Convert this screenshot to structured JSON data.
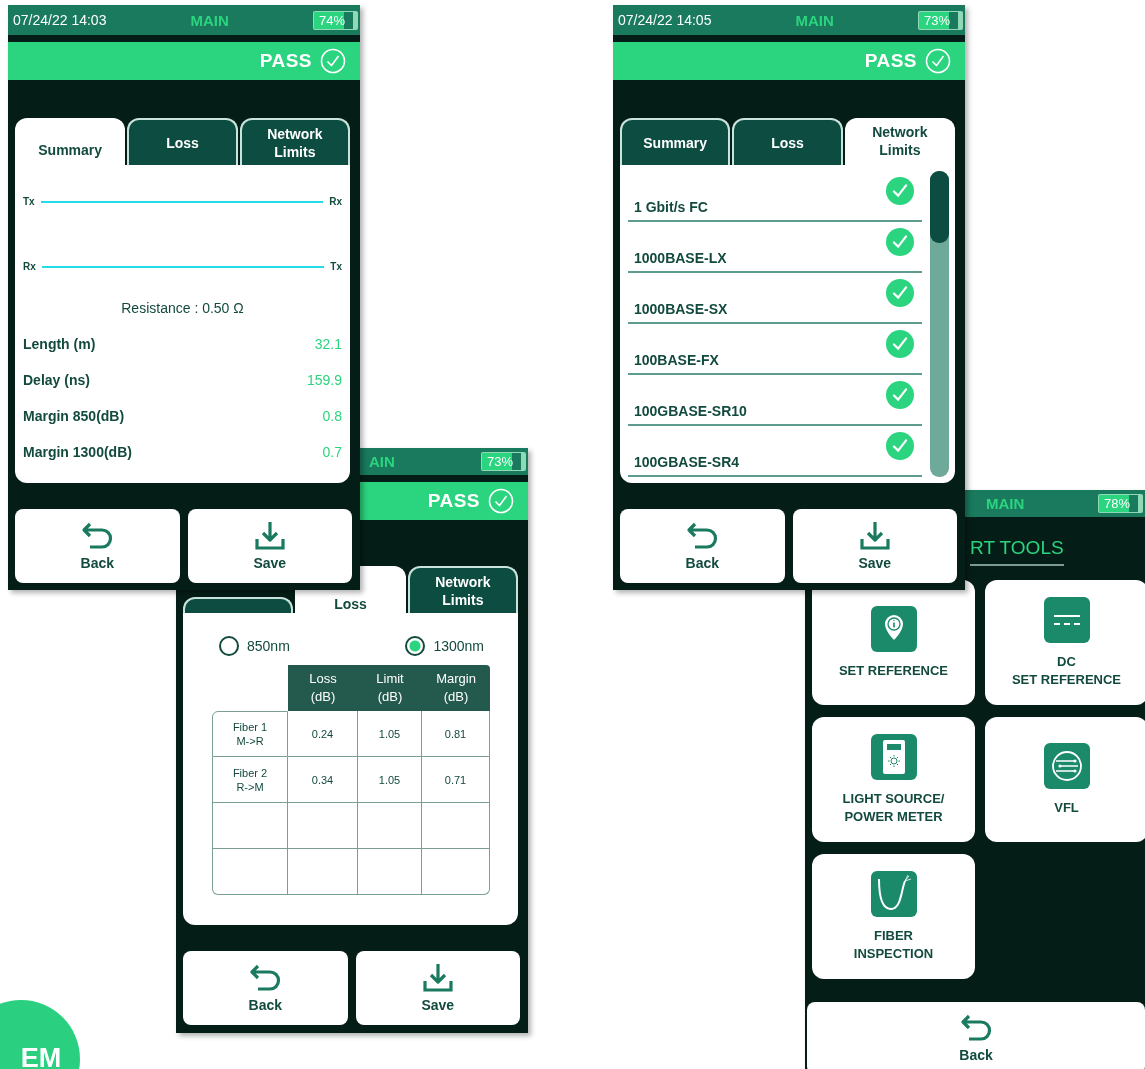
{
  "screens": [
    {
      "kind": "summary",
      "status": {
        "datetime": "07/24/22 14:03",
        "title": "MAIN",
        "battery": "74%"
      },
      "result": "PASS",
      "tabs": [
        {
          "label": "Summary",
          "selected": true
        },
        {
          "label": "Loss",
          "selected": false
        },
        {
          "label": "Network\nLimits",
          "selected": false
        }
      ],
      "links": [
        {
          "left": "Tx",
          "right": "Rx"
        },
        {
          "left": "Rx",
          "right": "Tx"
        }
      ],
      "resistance": "Resistance : 0.50 Ω",
      "measurements": [
        {
          "label": "Length (m)",
          "value": "32.1"
        },
        {
          "label": "Delay (ns)",
          "value": "159.9"
        },
        {
          "label": "Margin 850(dB)",
          "value": "0.8"
        },
        {
          "label": "Margin 1300(dB)",
          "value": "0.7"
        }
      ],
      "buttons": [
        "Back",
        "Save"
      ]
    },
    {
      "kind": "loss",
      "status": {
        "title": "AIN",
        "battery": "73%"
      },
      "result": "PASS",
      "tabs": [
        {
          "selected": false
        },
        {
          "label": "Loss",
          "selected": true
        },
        {
          "label": "Network\nLimits",
          "selected": false
        }
      ],
      "wavelengths": [
        {
          "label": "850nm",
          "selected": false
        },
        {
          "label": "1300nm",
          "selected": true
        }
      ],
      "table": {
        "columns": [
          "Loss\n(dB)",
          "Limit\n(dB)",
          "Margin\n(dB)"
        ],
        "rows": [
          {
            "label": "Fiber 1\nM->R",
            "cells": [
              "0.24",
              "1.05",
              "0.81"
            ]
          },
          {
            "label": "Fiber 2\nR->M",
            "cells": [
              "0.34",
              "1.05",
              "0.71"
            ]
          }
        ]
      },
      "buttons": [
        "Back",
        "Save"
      ]
    },
    {
      "kind": "limits",
      "status": {
        "datetime": "07/24/22 14:05",
        "title": "MAIN",
        "battery": "73%"
      },
      "result": "PASS",
      "tabs": [
        {
          "label": "Summary",
          "selected": false
        },
        {
          "label": "Loss",
          "selected": false
        },
        {
          "label": "Network\nLimits",
          "selected": true
        }
      ],
      "standards": [
        {
          "name": "1 Gbit/s FC",
          "passed": true
        },
        {
          "name": "1000BASE-LX",
          "passed": true
        },
        {
          "name": "1000BASE-SX",
          "passed": true
        },
        {
          "name": "100BASE-FX",
          "passed": true
        },
        {
          "name": "100GBASE-SR10",
          "passed": true
        },
        {
          "name": "100GBASE-SR4",
          "passed": true
        }
      ],
      "buttons": [
        "Back",
        "Save"
      ]
    },
    {
      "kind": "tools",
      "status": {
        "title": "MAIN",
        "battery": "78%"
      },
      "heading": "RT TOOLS",
      "tools": [
        {
          "label": "SET REFERENCE"
        },
        {
          "label": "DC\nSET REFERENCE"
        },
        {
          "label": "LIGHT SOURCE/\nPOWER METER"
        },
        {
          "label": "VFL"
        },
        {
          "label": "FIBER\nINSPECTION"
        }
      ],
      "buttons": [
        "Back"
      ]
    }
  ],
  "logo": {
    "text": "EM"
  }
}
